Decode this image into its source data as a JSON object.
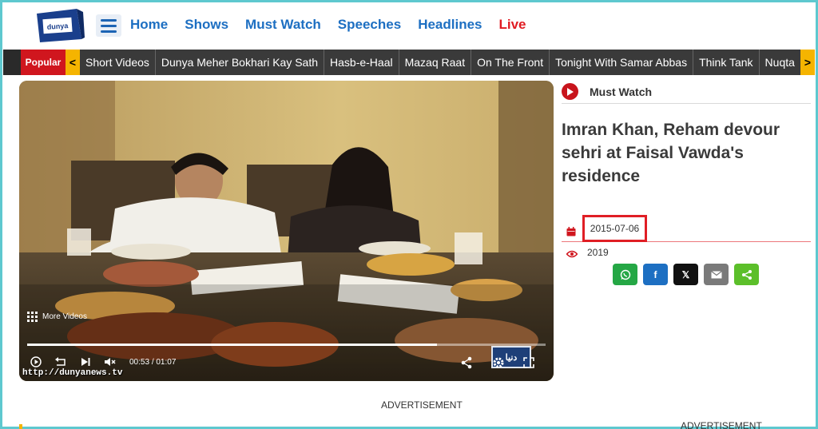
{
  "header": {
    "logo_text": "dunya",
    "nav": [
      "Home",
      "Shows",
      "Must Watch",
      "Speeches",
      "Headlines",
      "Live"
    ]
  },
  "popular": {
    "label": "Popular",
    "prev": "<",
    "next": ">",
    "items": [
      "Short Videos",
      "Dunya Meher Bokhari Kay Sath",
      "Hasb-e-Haal",
      "Mazaq Raat",
      "On The Front",
      "Tonight With Samar Abbas",
      "Think Tank",
      "Nuqta"
    ]
  },
  "video": {
    "more_videos": "More Videos",
    "current_time": "00:53",
    "separator": "/",
    "duration": "01:07",
    "progress": 0.79,
    "watermark": "http://dunyanews.tv",
    "logo": "دنیا"
  },
  "article": {
    "section": "Must Watch",
    "headline": "Imran Khan, Reham devour sehri at Faisal Vawda's residence",
    "date": "2015-07-06",
    "views": "2019"
  },
  "share": [
    {
      "name": "whatsapp",
      "color": "#25a745"
    },
    {
      "name": "facebook",
      "label": "f",
      "color": "#1d6fc2"
    },
    {
      "name": "x",
      "label": "𝕏",
      "color": "#111111"
    },
    {
      "name": "email",
      "color": "#7a7a7a"
    },
    {
      "name": "share",
      "color": "#5cbf2a"
    }
  ],
  "ads": {
    "left": "ADVERTISEMENT",
    "right": "ADVERTISEMENT"
  }
}
